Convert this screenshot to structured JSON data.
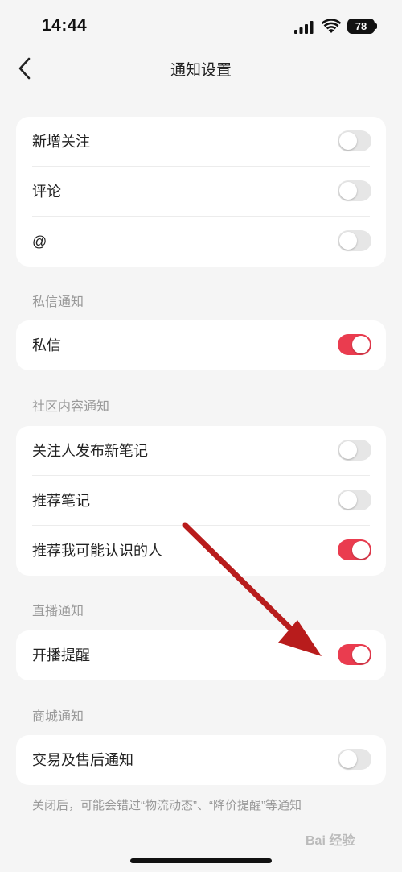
{
  "status_bar": {
    "time": "14:44",
    "battery": "78"
  },
  "nav": {
    "title": "通知设置"
  },
  "groups": [
    {
      "header": "",
      "items": [
        {
          "label": "新增关注",
          "on": false
        },
        {
          "label": "评论",
          "on": false
        },
        {
          "label": "@",
          "on": false
        }
      ]
    },
    {
      "header": "私信通知",
      "items": [
        {
          "label": "私信",
          "on": true
        }
      ]
    },
    {
      "header": "社区内容通知",
      "items": [
        {
          "label": "关注人发布新笔记",
          "on": false
        },
        {
          "label": "推荐笔记",
          "on": false
        },
        {
          "label": "推荐我可能认识的人",
          "on": true
        }
      ]
    },
    {
      "header": "直播通知",
      "items": [
        {
          "label": "开播提醒",
          "on": true
        }
      ]
    },
    {
      "header": "商城通知",
      "items": [
        {
          "label": "交易及售后通知",
          "on": false
        }
      ]
    }
  ],
  "footnote": "关闭后，可能会错过“物流动态”、“降价提醒”等通知",
  "watermark": "Bai 经验",
  "colors": {
    "toggle_on": "#ea3c4f",
    "toggle_off": "#e6e6e6",
    "arrow": "#b81c1c"
  }
}
